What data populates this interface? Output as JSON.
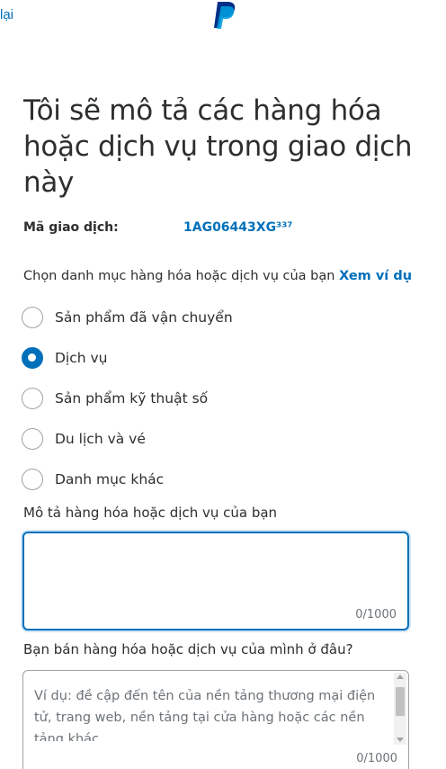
{
  "header": {
    "back_label": "lại",
    "logo_icon": "paypal-logo-icon"
  },
  "heading": "Tôi sẽ mô tả các hàng hóa hoặc dịch vụ trong giao dịch này",
  "transaction": {
    "label": "Mã giao dịch:",
    "value": "1AG06443XG³³⁷"
  },
  "category": {
    "prompt": "Chọn danh mục hàng hóa hoặc dịch vụ của bạn",
    "see_examples": "Xem ví dụ",
    "options": [
      {
        "label": "Sản phẩm đã vận chuyển",
        "checked": false
      },
      {
        "label": "Dịch vụ",
        "checked": true
      },
      {
        "label": "Sản phẩm kỹ thuật số",
        "checked": false
      },
      {
        "label": "Du lịch và vé",
        "checked": false
      },
      {
        "label": "Danh mục khác",
        "checked": false
      }
    ]
  },
  "description": {
    "label": "Mô tả hàng hóa hoặc dịch vụ của bạn",
    "value": "",
    "counter": "0/1000"
  },
  "where_sold": {
    "label": "Bạn bán hàng hóa hoặc dịch vụ của mình ở đâu?",
    "placeholder": "Ví dụ: đề cập đến tên của nền tảng thương mại điện tử, trang web, nền tảng tại cửa hàng hoặc các nền tảng khác",
    "counter": "0/1000"
  },
  "colors": {
    "accent": "#0070ba",
    "logo_dark": "#003087",
    "logo_light": "#009cde",
    "text": "#2c2e2f"
  }
}
